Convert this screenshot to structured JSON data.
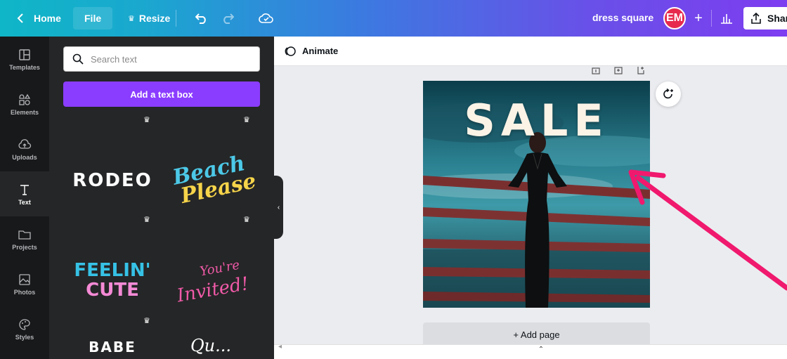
{
  "topbar": {
    "home_label": "Home",
    "file_label": "File",
    "resize_label": "Resize",
    "doc_title": "dress square",
    "avatar_initials": "EM",
    "share_label": "Share"
  },
  "rail": {
    "items": [
      {
        "label": "Templates",
        "icon": "templates-icon"
      },
      {
        "label": "Elements",
        "icon": "elements-icon"
      },
      {
        "label": "Uploads",
        "icon": "uploads-icon"
      },
      {
        "label": "Text",
        "icon": "text-icon",
        "active": true
      },
      {
        "label": "Projects",
        "icon": "folder-icon"
      },
      {
        "label": "Photos",
        "icon": "photos-icon"
      },
      {
        "label": "Styles",
        "icon": "palette-icon"
      }
    ]
  },
  "panel": {
    "search_placeholder": "Search text",
    "add_text_label": "Add a text box",
    "tiles": [
      {
        "text": "RODEO"
      },
      {
        "line1": "Beach",
        "line2": "Please"
      },
      {
        "line1": "FEELIN'",
        "line2": "CUTE"
      },
      {
        "line1": "You're",
        "line2": "Invited!"
      },
      {
        "text": "BABE"
      },
      {
        "text": "Qu..."
      }
    ]
  },
  "workspace": {
    "animate_label": "Animate",
    "canvas_text": "SALE",
    "add_page_label": "+ Add page"
  },
  "colors": {
    "accent_purple": "#8b3dff",
    "annotation_arrow": "#f0196e",
    "avatar_red": "#e7294d"
  }
}
